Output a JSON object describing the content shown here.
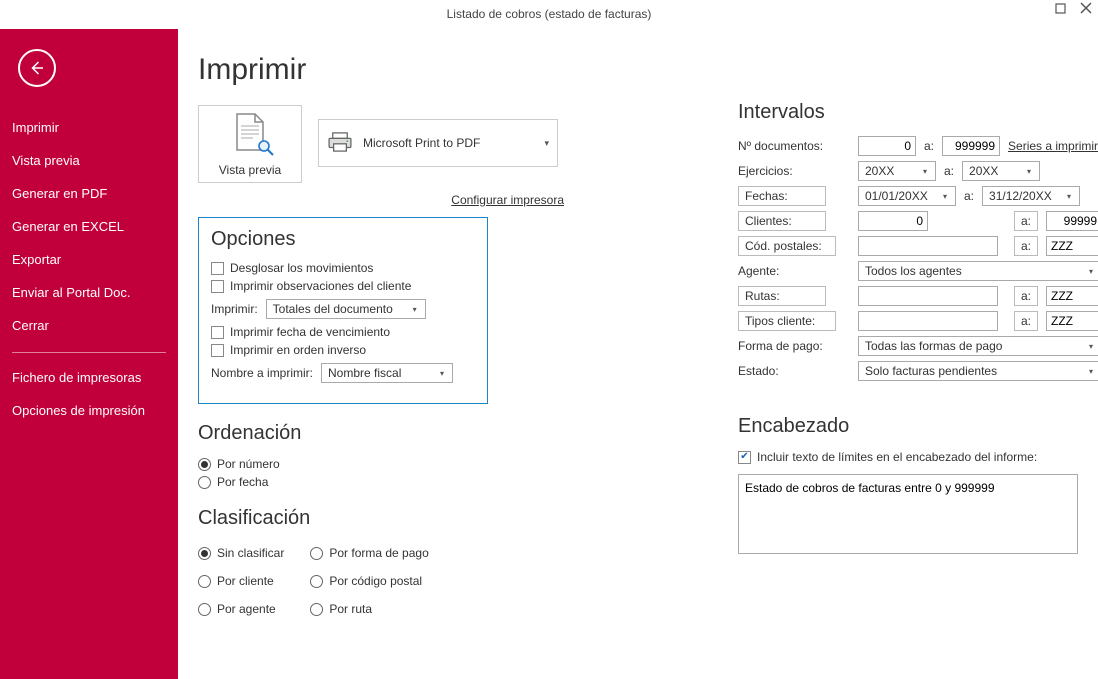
{
  "window": {
    "title": "Listado de cobros (estado de facturas)"
  },
  "sidebar": {
    "items": [
      "Imprimir",
      "Vista previa",
      "Generar en PDF",
      "Generar en EXCEL",
      "Exportar",
      "Enviar al Portal Doc.",
      "Cerrar"
    ],
    "extra": [
      "Fichero de impresoras",
      "Opciones de impresión"
    ]
  },
  "page": {
    "title": "Imprimir",
    "preview_label": "Vista previa",
    "printer_name": "Microsoft Print to PDF",
    "configure_printer": "Configurar impresora"
  },
  "opciones": {
    "title": "Opciones",
    "desglosar": "Desglosar los movimientos",
    "observaciones": "Imprimir observaciones del cliente",
    "imprimir_label": "Imprimir:",
    "imprimir_value": "Totales del documento",
    "fecha_venc": "Imprimir fecha de vencimiento",
    "orden_inverso": "Imprimir en orden inverso",
    "nombre_label": "Nombre a imprimir:",
    "nombre_value": "Nombre fiscal"
  },
  "ordenacion": {
    "title": "Ordenación",
    "por_numero": "Por número",
    "por_fecha": "Por fecha"
  },
  "clasificacion": {
    "title": "Clasificación",
    "col1": [
      "Sin clasificar",
      "Por cliente",
      "Por agente"
    ],
    "col2": [
      "Por forma de pago",
      "Por código postal",
      "Por ruta"
    ]
  },
  "intervalos": {
    "title": "Intervalos",
    "ndoc_label": "Nº documentos:",
    "ndoc_from": "0",
    "ndoc_to": "999999",
    "series_link": "Series a imprimir:",
    "ejercicios_label": "Ejercicios:",
    "ejercicios_from": "20XX",
    "ejercicios_to": "20XX",
    "fechas_label": "Fechas:",
    "fechas_from": "01/01/20XX",
    "fechas_to": "31/12/20XX",
    "clientes_label": "Clientes:",
    "clientes_from": "0",
    "clientes_to": "99999",
    "cpost_label": "Cód. postales:",
    "cpost_from": "",
    "cpost_to": "ZZZ",
    "agente_label": "Agente:",
    "agente_value": "Todos los agentes",
    "rutas_label": "Rutas:",
    "rutas_from": "",
    "rutas_to": "ZZZ",
    "tipos_label": "Tipos cliente:",
    "tipos_from": "",
    "tipos_to": "ZZZ",
    "fpago_label": "Forma de pago:",
    "fpago_value": "Todas las formas de pago",
    "estado_label": "Estado:",
    "estado_value": "Solo facturas pendientes",
    "a": "a:"
  },
  "encabezado": {
    "title": "Encabezado",
    "include_label": "Incluir texto de límites en el encabezado del informe:",
    "text": "Estado de cobros de facturas entre 0 y 999999"
  }
}
